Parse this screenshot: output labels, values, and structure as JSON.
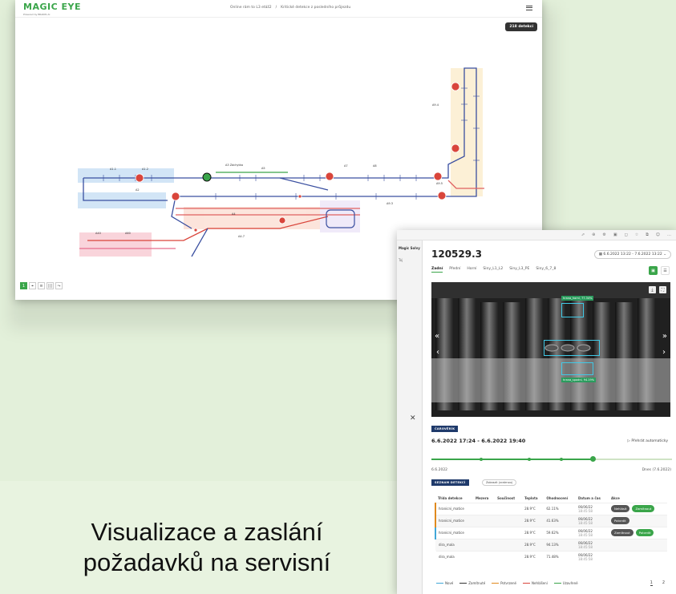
{
  "map": {
    "logo": "MAGIC EYE",
    "logo_sub": "Powered by BRAINS AI",
    "breadcrumb": [
      "Online rám to L3 etáž2",
      "/",
      "Kritické detekce z posledního průjezdu"
    ],
    "detections_badge": "218 detekcí",
    "tools": [
      "1",
      "⌖",
      "≡",
      "|||",
      "⤳"
    ]
  },
  "browser": {
    "icons": [
      "⬀",
      "⊕",
      "⚙",
      "▣",
      "◻",
      "☆",
      "⧉",
      "☺",
      "…"
    ]
  },
  "sidebar": {
    "title": "Magic Solvy",
    "item": "Toj"
  },
  "detail": {
    "title": "120529.3",
    "date_range": "6.6.2022 13:22 - 7.6.2022 13:22",
    "tabs": [
      "Zadní",
      "Přední",
      "Horní",
      "Siny_L1_L2",
      "Siny_L3_PE",
      "Siny_6_7_8"
    ],
    "labels": {
      "top": "hrana_horní, 77.34%",
      "bottom": "hrana_spodní, 94.19%"
    },
    "status": "ČAROVĚRÍK",
    "range_text": "6.6.2022 17:24 - 6.6.2022 19:40",
    "play_label": "Přehrát automaticky",
    "timeline_start": "6.6.2022",
    "timeline_end": "Dnes (7.6.2022)",
    "list_label": "SEZNAM DETEKCÍ",
    "show_all": "Zobrazit (vratrnou)",
    "columns": [
      "Třída detekce",
      "Mezera",
      "Součinost",
      "Teplota",
      "Ohodnocení",
      "Datum a čas",
      "Akce"
    ],
    "rows": [
      {
        "cls": "hranicni_matice",
        "temp": "28.9°C",
        "score": "62.11%",
        "date": "06/06/22",
        "time": "18:45:58",
        "actions": [
          "Nehlásit",
          "Zamítnout"
        ]
      },
      {
        "cls": "hranicni_matice",
        "temp": "28.9°C",
        "score": "41.63%",
        "date": "06/06/22",
        "time": "18:45:58",
        "actions": [
          "Potvrdit"
        ]
      },
      {
        "cls": "hranicni_matice",
        "temp": "28.9°C",
        "score": "59.62%",
        "date": "06/06/22",
        "time": "18:45:58",
        "actions": [
          "Zamítnout",
          "Potvrdit"
        ]
      },
      {
        "cls": "dira_mala",
        "temp": "28.9°C",
        "score": "94.13%",
        "date": "06/06/22",
        "time": "18:45:58",
        "actions": []
      },
      {
        "cls": "dira_mala",
        "temp": "28.9°C",
        "score": "71.48%",
        "date": "06/06/22",
        "time": "18:45:58",
        "actions": []
      }
    ],
    "legend": [
      {
        "label": "Nové",
        "color": "#41a7d8"
      },
      {
        "label": "Zamítnuté",
        "color": "#333333"
      },
      {
        "label": "Potvrzené",
        "color": "#e08a1e"
      },
      {
        "label": "Nehlášení",
        "color": "#d9453b"
      },
      {
        "label": "Uzavřené",
        "color": "#3aa54a"
      }
    ],
    "pages": [
      "1",
      "2"
    ]
  },
  "caption": {
    "line1": "Visualizace a zaslání",
    "line2": "požadavků na servisní"
  }
}
